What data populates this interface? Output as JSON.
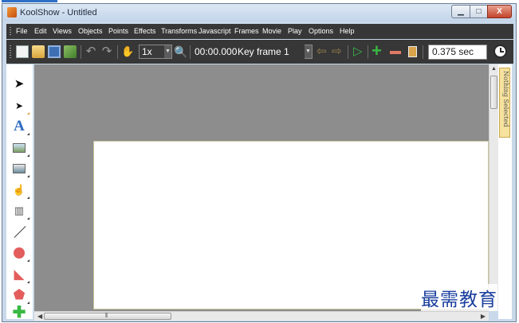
{
  "window": {
    "title": "KoolShow - Untitled",
    "controls": {
      "minimize": "▁",
      "maximize": "□",
      "close": "X"
    }
  },
  "menubar": {
    "items": [
      "File",
      "Edit",
      "Views",
      "Objects",
      "Points",
      "Effects",
      "Transforms",
      "Javascript",
      "Frames",
      "Movie",
      "Play",
      "Options",
      "Help"
    ]
  },
  "toolbar": {
    "icons": [
      "new-page",
      "open-folder",
      "save",
      "copy",
      "undo",
      "redo",
      "hand",
      "zoom",
      "prev-frame",
      "next-frame",
      "play",
      "add-frame",
      "remove-frame",
      "frame-properties",
      "clock"
    ],
    "zoom_value": "1x",
    "time_value": "00:00.000",
    "keyframe_value": "Key frame 1",
    "duration_value": "0.375 sec"
  },
  "toolbox": {
    "tools": [
      "select-arrow",
      "point-select",
      "text",
      "image",
      "image-sequence",
      "button",
      "film",
      "line",
      "circle",
      "path",
      "polygon",
      "add-point"
    ]
  },
  "side_panel": {
    "label": "Nothing Selected"
  },
  "watermark": "最需教育",
  "colors": {
    "dark_bar": "#373737",
    "canvas_bg": "#8d8d8d",
    "side_tab": "#f6e29e",
    "accent_green": "#39b843"
  }
}
